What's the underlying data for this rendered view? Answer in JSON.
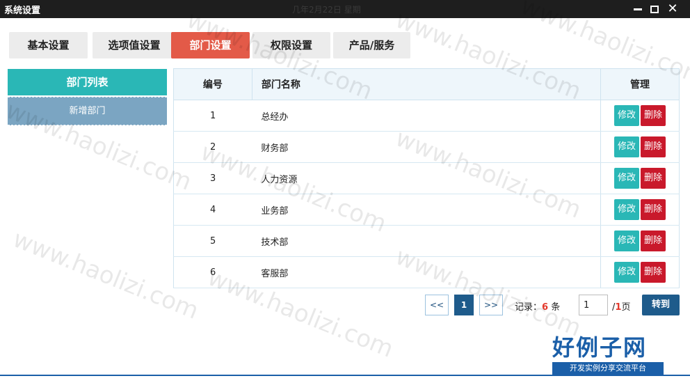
{
  "window": {
    "title": "系统设置",
    "ghost_text": "几年2月22日 星期"
  },
  "tabs": [
    {
      "label": "基本设置",
      "active": false
    },
    {
      "label": "选项值设置",
      "active": false
    },
    {
      "label": "部门设置",
      "active": true
    },
    {
      "label": "权限设置",
      "active": false
    },
    {
      "label": "产品/服务",
      "active": false
    }
  ],
  "sidebar": {
    "header": "部门列表",
    "items": [
      "新增部门"
    ]
  },
  "table": {
    "columns": [
      "编号",
      "部门名称",
      "管理"
    ],
    "rows": [
      {
        "id": "1",
        "name": "总经办"
      },
      {
        "id": "2",
        "name": "财务部"
      },
      {
        "id": "3",
        "name": "人力资源"
      },
      {
        "id": "4",
        "name": "业务部"
      },
      {
        "id": "5",
        "name": "技术部"
      },
      {
        "id": "6",
        "name": "客服部"
      }
    ],
    "edit_label": "修改",
    "delete_label": "删除"
  },
  "pager": {
    "prev_label": "<<",
    "current_page": "1",
    "next_label": ">>",
    "records_label": "记录：",
    "records_count": "6",
    "records_unit": "条",
    "page_input": "1",
    "total_prefix": "/",
    "total_pages": "1",
    "total_suffix": "页",
    "go_label": "转到"
  },
  "watermark": {
    "logo": "好例子网",
    "tagline": "开发实例分享交流平台",
    "text": "www.haolizi.com"
  },
  "colors": {
    "accent_teal": "#2ab7b6",
    "active_tab": "#e35a48",
    "danger": "#c9192b",
    "primary_blue": "#1e5b8b"
  }
}
